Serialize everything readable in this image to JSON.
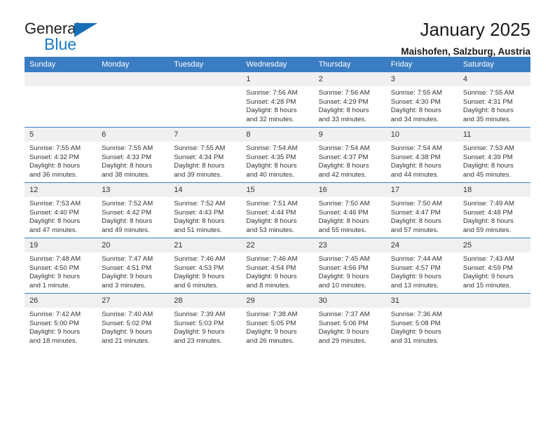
{
  "brand": {
    "name_top": "General",
    "name_bottom": "Blue",
    "color_dark": "#231f20",
    "color_blue": "#176fb5"
  },
  "header": {
    "title": "January 2025",
    "location": "Maishofen, Salzburg, Austria"
  },
  "theme": {
    "header_blue": "#3b7dc3",
    "daynum_bg": "#f0f0f0",
    "text": "#333333"
  },
  "weekday_headers": [
    "Sunday",
    "Monday",
    "Tuesday",
    "Wednesday",
    "Thursday",
    "Friday",
    "Saturday"
  ],
  "weeks": [
    [
      {
        "day": "",
        "lines": []
      },
      {
        "day": "",
        "lines": []
      },
      {
        "day": "",
        "lines": []
      },
      {
        "day": "1",
        "lines": [
          "Sunrise: 7:56 AM",
          "Sunset: 4:28 PM",
          "Daylight: 8 hours",
          "and 32 minutes."
        ]
      },
      {
        "day": "2",
        "lines": [
          "Sunrise: 7:56 AM",
          "Sunset: 4:29 PM",
          "Daylight: 8 hours",
          "and 33 minutes."
        ]
      },
      {
        "day": "3",
        "lines": [
          "Sunrise: 7:55 AM",
          "Sunset: 4:30 PM",
          "Daylight: 8 hours",
          "and 34 minutes."
        ]
      },
      {
        "day": "4",
        "lines": [
          "Sunrise: 7:55 AM",
          "Sunset: 4:31 PM",
          "Daylight: 8 hours",
          "and 35 minutes."
        ]
      }
    ],
    [
      {
        "day": "5",
        "lines": [
          "Sunrise: 7:55 AM",
          "Sunset: 4:32 PM",
          "Daylight: 8 hours",
          "and 36 minutes."
        ]
      },
      {
        "day": "6",
        "lines": [
          "Sunrise: 7:55 AM",
          "Sunset: 4:33 PM",
          "Daylight: 8 hours",
          "and 38 minutes."
        ]
      },
      {
        "day": "7",
        "lines": [
          "Sunrise: 7:55 AM",
          "Sunset: 4:34 PM",
          "Daylight: 8 hours",
          "and 39 minutes."
        ]
      },
      {
        "day": "8",
        "lines": [
          "Sunrise: 7:54 AM",
          "Sunset: 4:35 PM",
          "Daylight: 8 hours",
          "and 40 minutes."
        ]
      },
      {
        "day": "9",
        "lines": [
          "Sunrise: 7:54 AM",
          "Sunset: 4:37 PM",
          "Daylight: 8 hours",
          "and 42 minutes."
        ]
      },
      {
        "day": "10",
        "lines": [
          "Sunrise: 7:54 AM",
          "Sunset: 4:38 PM",
          "Daylight: 8 hours",
          "and 44 minutes."
        ]
      },
      {
        "day": "11",
        "lines": [
          "Sunrise: 7:53 AM",
          "Sunset: 4:39 PM",
          "Daylight: 8 hours",
          "and 45 minutes."
        ]
      }
    ],
    [
      {
        "day": "12",
        "lines": [
          "Sunrise: 7:53 AM",
          "Sunset: 4:40 PM",
          "Daylight: 8 hours",
          "and 47 minutes."
        ]
      },
      {
        "day": "13",
        "lines": [
          "Sunrise: 7:52 AM",
          "Sunset: 4:42 PM",
          "Daylight: 8 hours",
          "and 49 minutes."
        ]
      },
      {
        "day": "14",
        "lines": [
          "Sunrise: 7:52 AM",
          "Sunset: 4:43 PM",
          "Daylight: 8 hours",
          "and 51 minutes."
        ]
      },
      {
        "day": "15",
        "lines": [
          "Sunrise: 7:51 AM",
          "Sunset: 4:44 PM",
          "Daylight: 8 hours",
          "and 53 minutes."
        ]
      },
      {
        "day": "16",
        "lines": [
          "Sunrise: 7:50 AM",
          "Sunset: 4:46 PM",
          "Daylight: 8 hours",
          "and 55 minutes."
        ]
      },
      {
        "day": "17",
        "lines": [
          "Sunrise: 7:50 AM",
          "Sunset: 4:47 PM",
          "Daylight: 8 hours",
          "and 57 minutes."
        ]
      },
      {
        "day": "18",
        "lines": [
          "Sunrise: 7:49 AM",
          "Sunset: 4:48 PM",
          "Daylight: 8 hours",
          "and 59 minutes."
        ]
      }
    ],
    [
      {
        "day": "19",
        "lines": [
          "Sunrise: 7:48 AM",
          "Sunset: 4:50 PM",
          "Daylight: 9 hours",
          "and 1 minute."
        ]
      },
      {
        "day": "20",
        "lines": [
          "Sunrise: 7:47 AM",
          "Sunset: 4:51 PM",
          "Daylight: 9 hours",
          "and 3 minutes."
        ]
      },
      {
        "day": "21",
        "lines": [
          "Sunrise: 7:46 AM",
          "Sunset: 4:53 PM",
          "Daylight: 9 hours",
          "and 6 minutes."
        ]
      },
      {
        "day": "22",
        "lines": [
          "Sunrise: 7:46 AM",
          "Sunset: 4:54 PM",
          "Daylight: 9 hours",
          "and 8 minutes."
        ]
      },
      {
        "day": "23",
        "lines": [
          "Sunrise: 7:45 AM",
          "Sunset: 4:56 PM",
          "Daylight: 9 hours",
          "and 10 minutes."
        ]
      },
      {
        "day": "24",
        "lines": [
          "Sunrise: 7:44 AM",
          "Sunset: 4:57 PM",
          "Daylight: 9 hours",
          "and 13 minutes."
        ]
      },
      {
        "day": "25",
        "lines": [
          "Sunrise: 7:43 AM",
          "Sunset: 4:59 PM",
          "Daylight: 9 hours",
          "and 15 minutes."
        ]
      }
    ],
    [
      {
        "day": "26",
        "lines": [
          "Sunrise: 7:42 AM",
          "Sunset: 5:00 PM",
          "Daylight: 9 hours",
          "and 18 minutes."
        ]
      },
      {
        "day": "27",
        "lines": [
          "Sunrise: 7:40 AM",
          "Sunset: 5:02 PM",
          "Daylight: 9 hours",
          "and 21 minutes."
        ]
      },
      {
        "day": "28",
        "lines": [
          "Sunrise: 7:39 AM",
          "Sunset: 5:03 PM",
          "Daylight: 9 hours",
          "and 23 minutes."
        ]
      },
      {
        "day": "29",
        "lines": [
          "Sunrise: 7:38 AM",
          "Sunset: 5:05 PM",
          "Daylight: 9 hours",
          "and 26 minutes."
        ]
      },
      {
        "day": "30",
        "lines": [
          "Sunrise: 7:37 AM",
          "Sunset: 5:06 PM",
          "Daylight: 9 hours",
          "and 29 minutes."
        ]
      },
      {
        "day": "31",
        "lines": [
          "Sunrise: 7:36 AM",
          "Sunset: 5:08 PM",
          "Daylight: 9 hours",
          "and 31 minutes."
        ]
      },
      {
        "day": "",
        "lines": []
      }
    ]
  ]
}
